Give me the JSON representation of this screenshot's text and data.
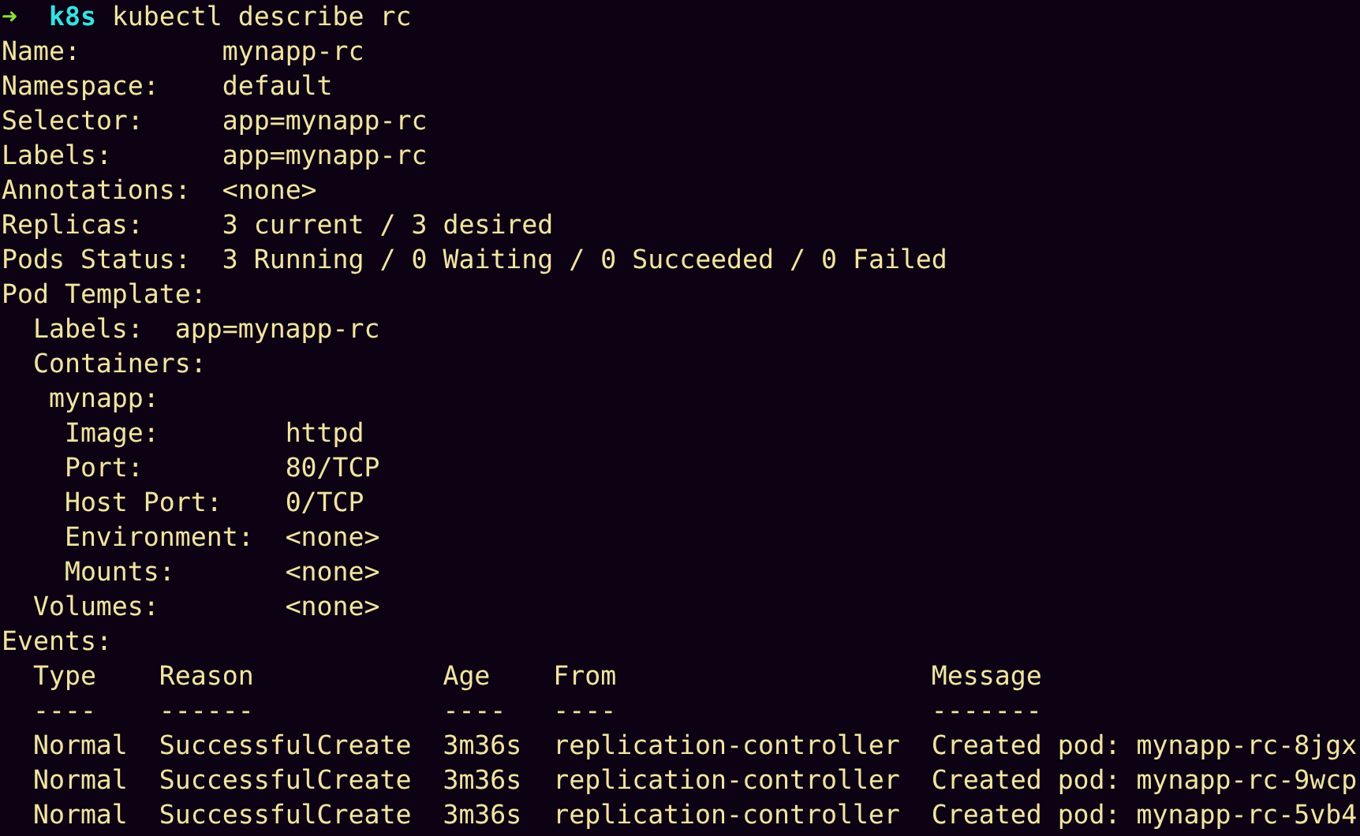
{
  "prompt": {
    "symbol": "➜",
    "directory": "k8s",
    "command": "kubectl describe rc"
  },
  "details": [
    {
      "label": "Name:",
      "value": "mynapp-rc"
    },
    {
      "label": "Namespace:",
      "value": "default"
    },
    {
      "label": "Selector:",
      "value": "app=mynapp-rc"
    },
    {
      "label": "Labels:",
      "value": "app=mynapp-rc"
    },
    {
      "label": "Annotations:",
      "value": "<none>"
    },
    {
      "label": "Replicas:",
      "value": "3 current / 3 desired"
    },
    {
      "label": "Pods Status:",
      "value": "3 Running / 0 Waiting / 0 Succeeded / 0 Failed"
    },
    {
      "label": "Pod Template:",
      "children": [
        {
          "label": "Labels:",
          "value": "app=mynapp-rc"
        },
        {
          "label": "Containers:",
          "children": [
            {
              "label": "mynapp:",
              "children": [
                {
                  "label": "Image:",
                  "value": "httpd"
                },
                {
                  "label": "Port:",
                  "value": "80/TCP"
                },
                {
                  "label": "Host Port:",
                  "value": "0/TCP"
                },
                {
                  "label": "Environment:",
                  "value": "<none>"
                },
                {
                  "label": "Mounts:",
                  "value": "<none>"
                }
              ]
            }
          ]
        },
        {
          "label": "Volumes:",
          "value": "<none>"
        }
      ]
    }
  ],
  "events": {
    "label": "Events:",
    "columns": [
      {
        "heading": "Type",
        "rule": "----"
      },
      {
        "heading": "Reason",
        "rule": "------"
      },
      {
        "heading": "Age",
        "rule": "----"
      },
      {
        "heading": "From",
        "rule": "----"
      },
      {
        "heading": "Message",
        "rule": "-------"
      }
    ],
    "rows": [
      [
        "Normal",
        "SuccessfulCreate",
        "3m36s",
        "replication-controller",
        "Created pod: mynapp-rc-8jgx"
      ],
      [
        "Normal",
        "SuccessfulCreate",
        "3m36s",
        "replication-controller",
        "Created pod: mynapp-rc-9wcp"
      ],
      [
        "Normal",
        "SuccessfulCreate",
        "3m36s",
        "replication-controller",
        "Created pod: mynapp-rc-5vb4"
      ]
    ]
  }
}
